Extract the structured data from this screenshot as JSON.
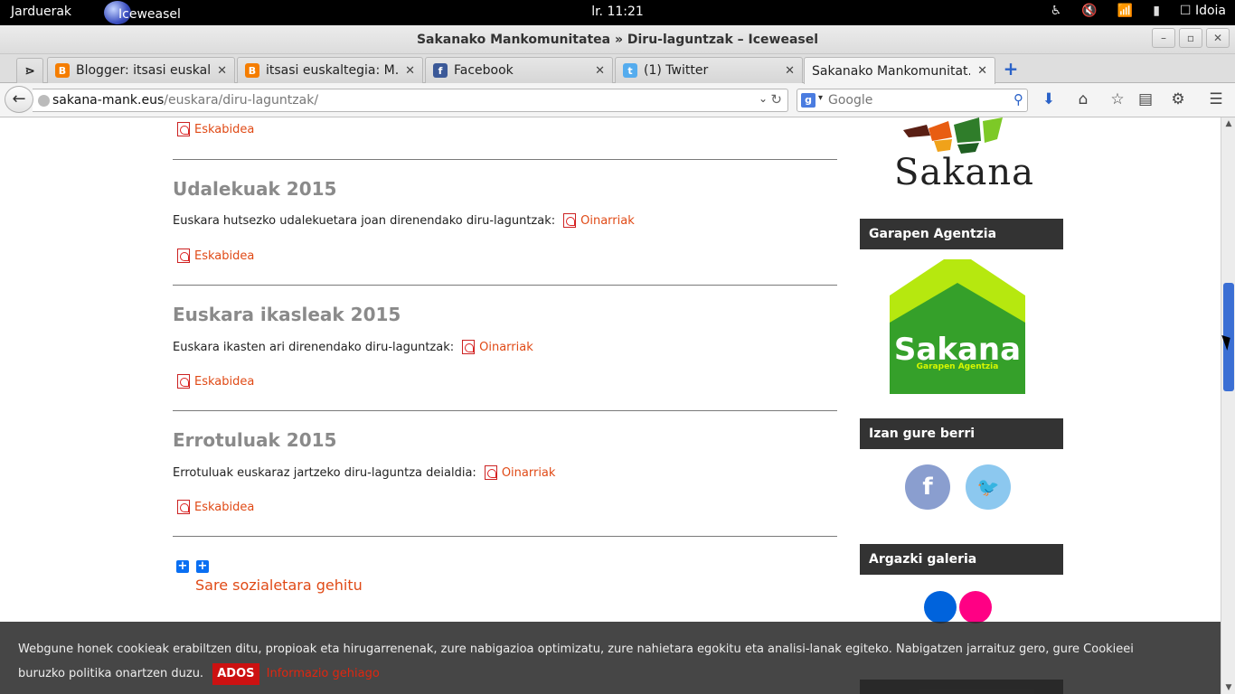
{
  "topbar": {
    "activities": "Jarduerak",
    "app_name": "Iceweasel",
    "clock": "lr. 11:21",
    "user": "Idoia"
  },
  "window": {
    "title": "Sakanako Mankomunitatea » Diru-laguntzak – Iceweasel"
  },
  "tabs": [
    {
      "label": "Blogger: itsasi euskal...",
      "icon": "blogger-icon",
      "color": "#f57d00"
    },
    {
      "label": "itsasi euskaltegia: M...",
      "icon": "blogger-icon",
      "color": "#f57d00"
    },
    {
      "label": "Facebook",
      "icon": "facebook-icon",
      "color": "#3b5998"
    },
    {
      "label": "(1) Twitter",
      "icon": "twitter-icon",
      "color": "#55acee"
    },
    {
      "label": "Sakanako Mankomunitat...",
      "icon": "page-icon",
      "color": "#999999"
    }
  ],
  "navbar": {
    "url_domain": "sakana-mank.eus",
    "url_path": "/euskara/diru-laguntzak/",
    "search_placeholder": "Google"
  },
  "content": {
    "top_link": "Eskabidea",
    "sections": [
      {
        "title": "Udalekuak 2015",
        "text": "Euskara hutsezko udalekuetara joan direnendako diru-laguntzak:",
        "inline_link": "Oinarriak",
        "link": "Eskabidea"
      },
      {
        "title": "Euskara ikasleak 2015",
        "text": "Euskara ikasten ari direnendako diru-laguntzak:",
        "inline_link": "Oinarriak",
        "link": "Eskabidea"
      },
      {
        "title": "Errotuluak 2015",
        "text": "Errotuluak euskaraz jartzeko diru-laguntza deialdia:",
        "inline_link": "Oinarriak",
        "link": "Eskabidea"
      }
    ],
    "share_link": "Sare sozialetara gehitu"
  },
  "sidebar": {
    "logo_text": "Sakana",
    "garapen_heading": "Garapen Agentzia",
    "garapen_logo_text": "Sakana",
    "garapen_logo_sub": "Garapen Agentzia",
    "social_heading": "Izan gure berri",
    "gallery_heading": "Argazki galeria"
  },
  "cookie": {
    "text": "Webgune honek cookieak erabiltzen ditu, propioak eta hirugarrenenak, zure nabigazioa optimizatu, zure nahietara egokitu eta analisi-lanak egiteko. Nabigatzen jarraituz gero, gure Cookieei buruzko politika onartzen duzu.",
    "accept": "ADOS",
    "more": "Informazio gehiago"
  },
  "colors": {
    "link": "#e04a16",
    "sidebar_header": "#333333",
    "scrollbar_thumb": "#3b6fd4"
  }
}
